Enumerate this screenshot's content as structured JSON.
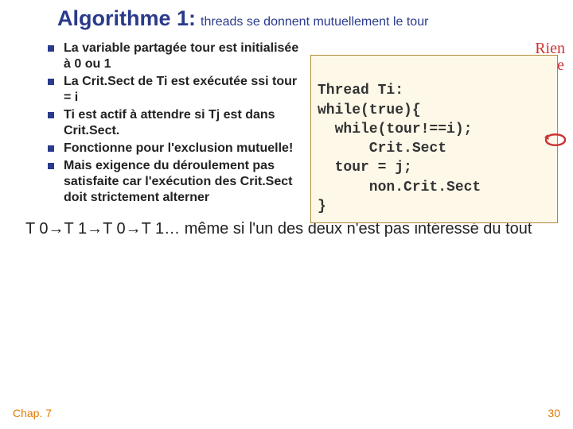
{
  "title": {
    "main": "Algorithme 1:",
    "sub": "threads se donnent mutuellement le tour"
  },
  "bullets": [
    "La variable partagée tour est initialisée à 0 ou 1",
    "La Crit.Sect de Ti est exécutée ssi tour = i",
    "Ti est actif à attendre si Tj est dans Crit.Sect.",
    "Fonctionne pour l'exclusion mutuelle!",
    "Mais exigence du déroulement pas satisfaite car  l'exécution des Crit.Sect doit strictement alterner"
  ],
  "annotation": {
    "line1": "Rien",
    "line2": "faire"
  },
  "code": "\nThread Ti:\nwhile(true){\n  while(tour!==i);\n      Crit.Sect\n  tour = j;\n      non.Crit.Sect\n}",
  "bottom": "T 0→T 1→T 0→T 1…  même si l'un des deux n'est pas intéressé du tout",
  "footer": {
    "chapter": "Chap. 7",
    "page": "30"
  }
}
